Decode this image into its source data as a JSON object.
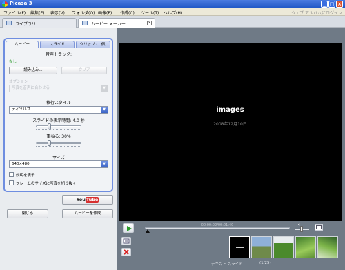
{
  "window": {
    "title": "Picasa 3"
  },
  "menu": {
    "items": [
      "ファイル(F)",
      "編集(E)",
      "表示(V)",
      "フォルダ(O)",
      "画像(P)",
      "作成(C)",
      "ツール(T)",
      "ヘルプ(H)"
    ],
    "web_link": "ウェブ アルバムにログイン"
  },
  "tabs": {
    "library": "ライブラリ",
    "movie_maker": "ムービー メーカー"
  },
  "panel_tabs": {
    "movie": "ムービー",
    "slide": "スライド",
    "clips": "クリップ (1 個)"
  },
  "audio": {
    "heading": "音声トラック:",
    "status": "なし",
    "load_button": "読み込み...",
    "clear_button": "クリア",
    "options_label": "オプション",
    "options_value": "写真を音声に合わせる"
  },
  "transition": {
    "heading": "移行スタイル",
    "style_value": "ディゾルブ",
    "duration_label": "スライドの表示時間: 4.0 秒",
    "duration_level": 0.3,
    "overlap_label": "重ねる: 30%",
    "overlap_level": 0.3
  },
  "size": {
    "heading": "サイズ",
    "value": "640×480",
    "show_captions": "説明を表示",
    "crop_to_fit": "フレームのサイズに写真を切り抜く"
  },
  "actions": {
    "youtube": "YouTube",
    "close": "閉じる",
    "create_movie": "ムービーを作成"
  },
  "preview": {
    "title": "images",
    "date": "2008年12月10日"
  },
  "playback": {
    "time": "00:00:02/00:01:40",
    "progress": 0.02
  },
  "status": {
    "label": "テキスト スライド",
    "count": "(1/25)"
  },
  "colors": {
    "accent": "#3c64c6",
    "youtube_red": "#d63030",
    "play_green": "#2a9a2a",
    "delete_red": "#d82020"
  }
}
